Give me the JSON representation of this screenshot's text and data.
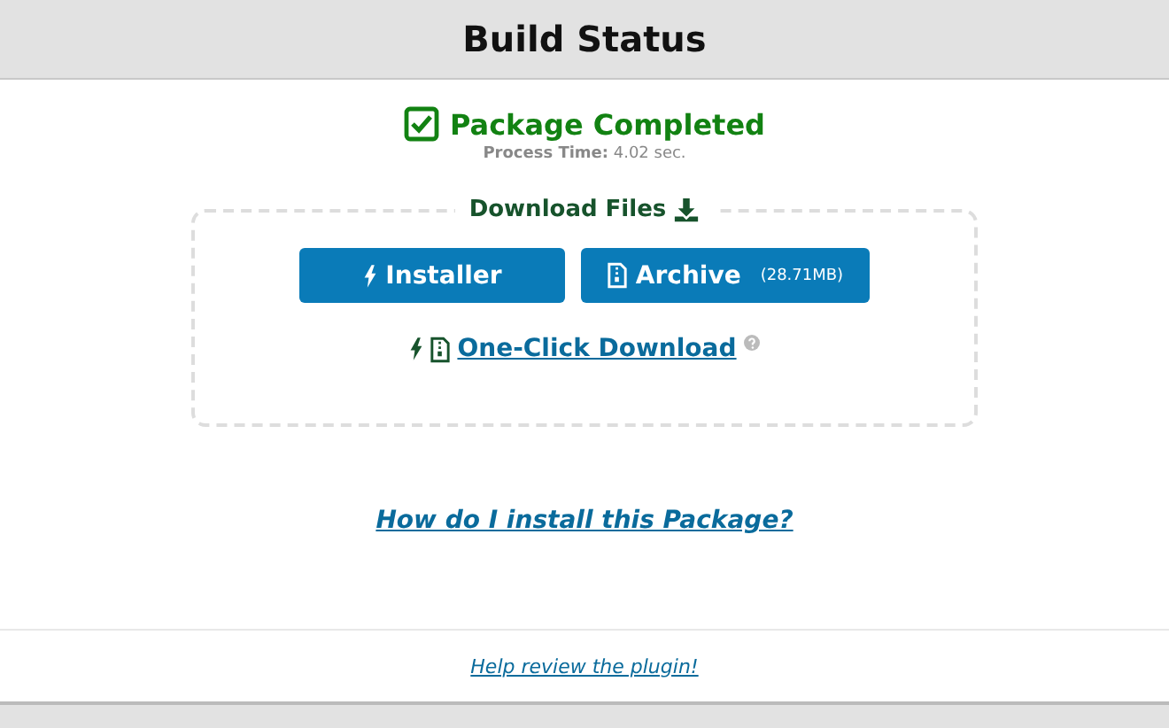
{
  "header": {
    "title": "Build Status"
  },
  "status": {
    "title": "Package Completed",
    "process_time": "**Process Time:** 4.02 sec."
  },
  "downloads": {
    "legend": "Download Files",
    "buttons": [
      {
        "label": "Installer",
        "kind": "installer"
      },
      {
        "label": "Archive",
        "size": "(28.71MB)",
        "kind": "archive"
      }
    ],
    "one_click": {
      "label": "One-Click Download"
    }
  },
  "help_link": "How do I install this Package?",
  "footer_link": "Help review the plugin!"
}
